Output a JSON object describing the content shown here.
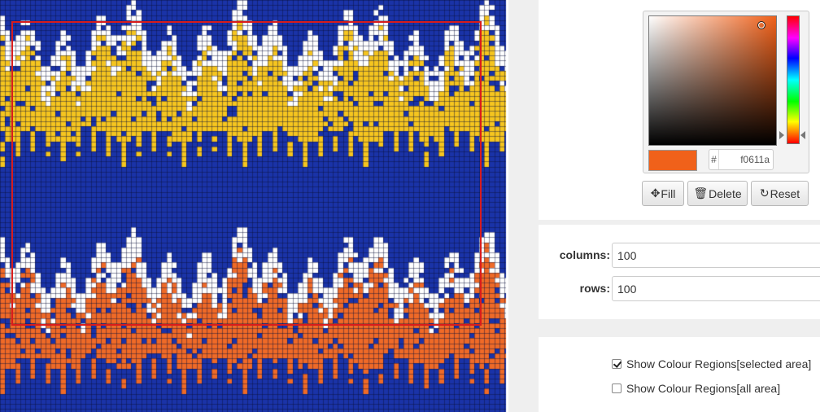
{
  "colors": {
    "background": "#1a33a8",
    "yellow": "#f5c51f",
    "white": "#ffffff",
    "orange": "#ef6a27",
    "gridline": "#0a0f3a",
    "selection": "#d81c1c",
    "selected_color": "#f0611a"
  },
  "picker": {
    "hex_prefix": "#",
    "hex_value": "f0611a"
  },
  "toolbar": {
    "fill_icon": "move-icon",
    "fill_label": "Fill",
    "delete_icon": "trash-icon",
    "delete_label": "Delete",
    "reset_icon": "refresh-icon",
    "reset_label": "Reset"
  },
  "grid_settings": {
    "columns_label": "columns:",
    "columns_value": "100",
    "rows_label": "rows:",
    "rows_value": "100"
  },
  "options": {
    "regions_selected_label": "Show Colour Regions[selected area]",
    "regions_selected_checked": true,
    "regions_all_label": "Show Colour Regions[all area]",
    "regions_all_checked": false
  }
}
